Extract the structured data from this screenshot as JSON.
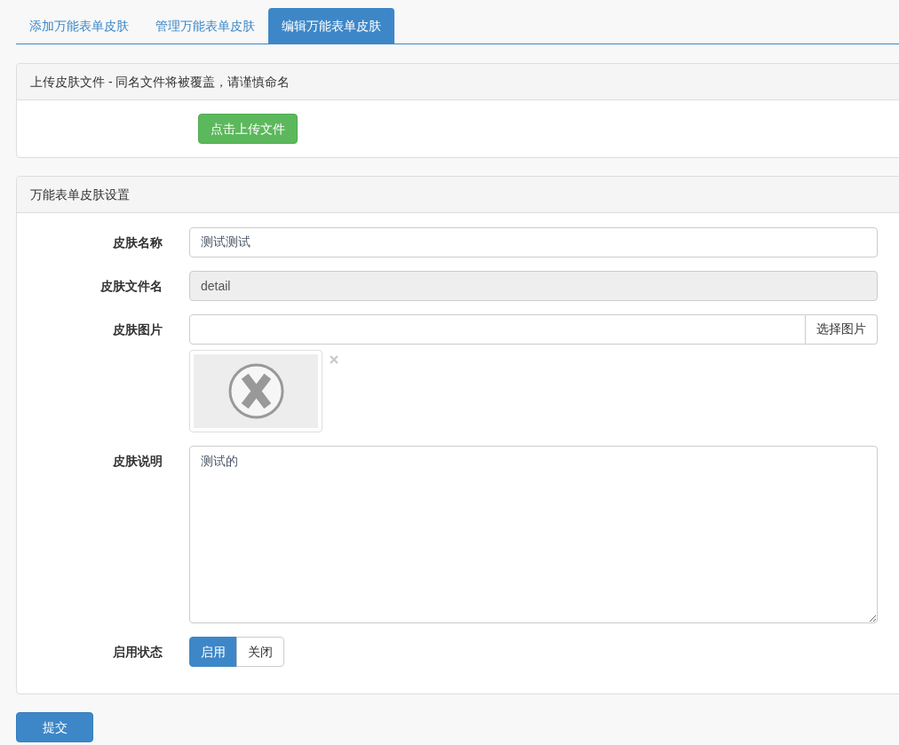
{
  "tabs": [
    {
      "label": "添加万能表单皮肤",
      "selected": false
    },
    {
      "label": "管理万能表单皮肤",
      "selected": false
    },
    {
      "label": "编辑万能表单皮肤",
      "selected": true
    }
  ],
  "upload_panel": {
    "title": "上传皮肤文件 - 同名文件将被覆盖，请谨慎命名",
    "upload_button": "点击上传文件"
  },
  "settings_panel": {
    "title": "万能表单皮肤设置",
    "fields": [
      {
        "kind": "text",
        "label": "皮肤名称",
        "value": "测试测试",
        "disabled": false
      },
      {
        "kind": "text",
        "label": "皮肤文件名",
        "value": "detail",
        "disabled": true
      },
      {
        "kind": "image",
        "label": "皮肤图片",
        "button": "选择图片",
        "disabled": false
      },
      {
        "kind": "textarea",
        "label": "皮肤说明",
        "value": "测试的",
        "disabled": false
      },
      {
        "kind": "toggle",
        "label": "启用状态",
        "options": [
          {
            "label": "启用",
            "selected": true
          },
          {
            "label": "关闭",
            "selected": false
          }
        ]
      }
    ]
  },
  "submit_button": "提交"
}
